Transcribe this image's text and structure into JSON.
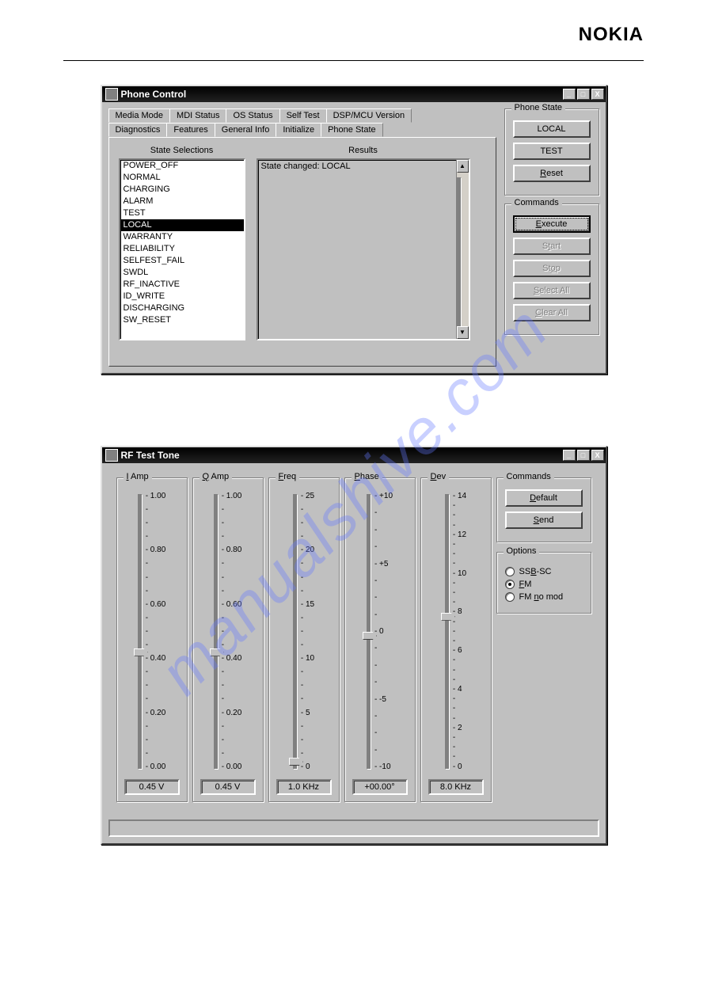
{
  "brand": "NOKIA",
  "watermark": "manualshive.com",
  "phone_control": {
    "title": "Phone Control",
    "tabs_back": [
      "Media Mode",
      "MDI Status",
      "OS Status",
      "Self Test",
      "DSP/MCU Version"
    ],
    "tabs_front": [
      "Diagnostics",
      "Features",
      "General Info",
      "Initialize",
      "Phone State"
    ],
    "active_tab": "Phone State",
    "state_selections_label": "State Selections",
    "results_label": "Results",
    "states": [
      "POWER_OFF",
      "NORMAL",
      "CHARGING",
      "ALARM",
      "TEST",
      "LOCAL",
      "WARRANTY",
      "RELIABILITY",
      "SELFEST_FAIL",
      "SWDL",
      "RF_INACTIVE",
      "ID_WRITE",
      "DISCHARGING",
      "SW_RESET"
    ],
    "selected_state": "LOCAL",
    "results_text": "State changed: LOCAL",
    "phone_state_group": "Phone State",
    "btn_local": "LOCAL",
    "btn_test": "TEST",
    "btn_reset": "Reset",
    "commands_group": "Commands",
    "btn_execute": "Execute",
    "btn_start": "Start",
    "btn_stop": "Stop",
    "btn_select_all": "Select All",
    "btn_clear_all": "Clear All"
  },
  "rf": {
    "title": "RF Test Tone",
    "sliders": {
      "iamp": {
        "label": "I Amp",
        "ticks": [
          "1.00",
          "0.80",
          "0.60",
          "0.40",
          "0.20",
          "0.00"
        ],
        "value": "0.45 V",
        "thumb_pct": 56
      },
      "qamp": {
        "label": "Q Amp",
        "ticks": [
          "1.00",
          "0.80",
          "0.60",
          "0.40",
          "0.20",
          "0.00"
        ],
        "value": "0.45 V",
        "thumb_pct": 56
      },
      "freq": {
        "label": "Freq",
        "ticks": [
          "25",
          "20",
          "15",
          "10",
          "5",
          "0"
        ],
        "value": "1.0 KHz",
        "thumb_pct": 96
      },
      "phase": {
        "label": "Phase",
        "ticks": [
          "+10",
          "+5",
          "0",
          "-5",
          "-10"
        ],
        "value": "+00.00°",
        "thumb_pct": 50
      },
      "dev": {
        "label": "Dev",
        "ticks": [
          "14",
          "12",
          "10",
          "8",
          "6",
          "4",
          "2",
          "0"
        ],
        "value": "8.0 KHz",
        "thumb_pct": 43
      }
    },
    "commands_group": "Commands",
    "btn_default": "Default",
    "btn_send": "Send",
    "options_group": "Options",
    "opt_ssb": "SSB-SC",
    "opt_fm": "FM",
    "opt_fm_nomod": "FM no mod",
    "selected_option": "FM"
  }
}
